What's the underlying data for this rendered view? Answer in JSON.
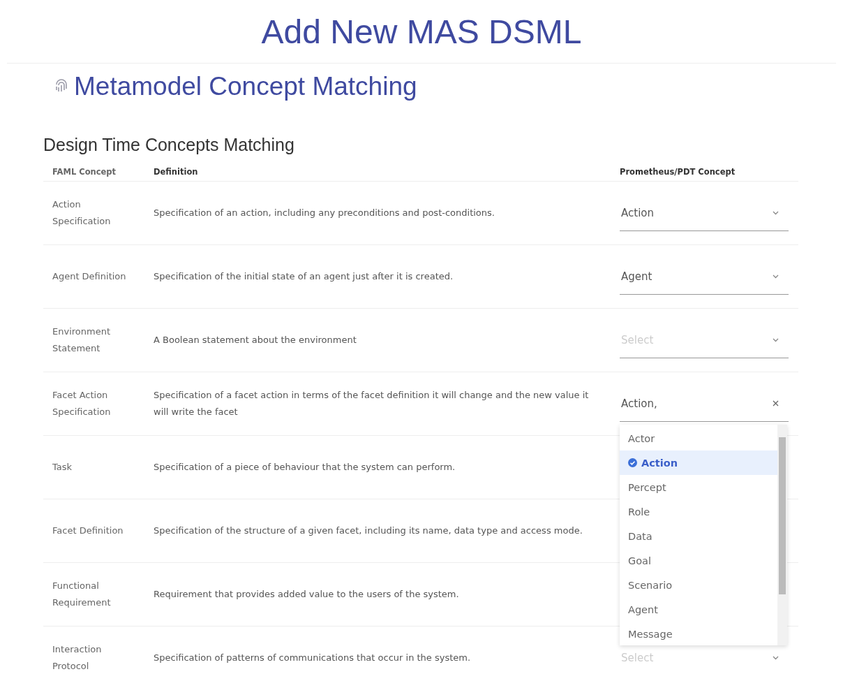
{
  "page_title": "Add New MAS DSML",
  "section_title": "Metamodel Concept Matching",
  "subsection_title": "Design Time Concepts Matching",
  "table": {
    "columns": [
      "FAML Concept",
      "Definition",
      "Prometheus/PDT Concept"
    ],
    "rows": [
      {
        "concept": "Action Specification",
        "definition": "Specification of an action, including any preconditions and post-conditions.",
        "select": {
          "value": "Action",
          "open": false
        }
      },
      {
        "concept": "Agent Definition",
        "definition": "Specification of the initial state of an agent just after it is created.",
        "select": {
          "value": "Agent",
          "open": false
        }
      },
      {
        "concept": "Environment Statement",
        "definition": "A Boolean statement about the environment",
        "select": {
          "placeholder": "Select",
          "open": false
        }
      },
      {
        "concept": "Facet Action Specification",
        "definition": "Specification of a facet action in terms of the facet definition it will change and the new value it will write the facet",
        "select": {
          "value": "Action,",
          "open": true,
          "options": [
            {
              "label": "Actor",
              "selected": false
            },
            {
              "label": "Action",
              "selected": true
            },
            {
              "label": "Percept",
              "selected": false
            },
            {
              "label": "Role",
              "selected": false
            },
            {
              "label": "Data",
              "selected": false
            },
            {
              "label": "Goal",
              "selected": false
            },
            {
              "label": "Scenario",
              "selected": false
            },
            {
              "label": "Agent",
              "selected": false
            },
            {
              "label": "Message",
              "selected": false
            }
          ]
        }
      },
      {
        "concept": "Task",
        "definition": "Specification of a piece of behaviour that the system can perform."
      },
      {
        "concept": "Facet Definition",
        "definition": "Specification of the structure of a given facet, including its name, data type and access mode."
      },
      {
        "concept": "Functional Requirement",
        "definition": "Requirement that provides added value to the users of the system."
      },
      {
        "concept": "Interaction Protocol",
        "definition": "Specification of patterns of communications that occur in the system.",
        "select": {
          "placeholder": "Select",
          "open": false
        }
      }
    ]
  }
}
